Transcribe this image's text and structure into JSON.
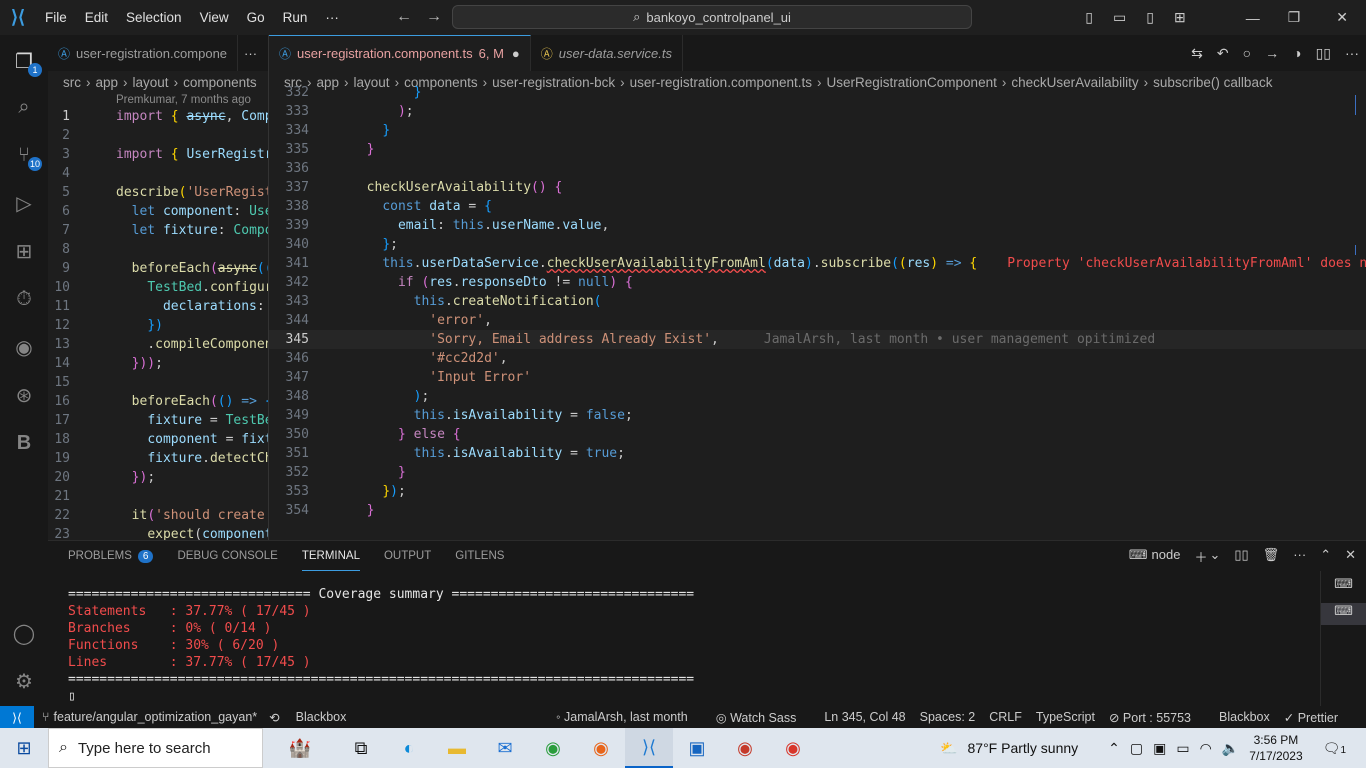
{
  "titlebar": {
    "menu": [
      "File",
      "Edit",
      "Selection",
      "View",
      "Go",
      "Run",
      "···"
    ],
    "search_text": "bankoyo_controlpanel_ui"
  },
  "activity": {
    "explorer_badge": "1",
    "scm_badge": "10"
  },
  "left_pane": {
    "tab_label": "user-registration.compone",
    "crumbs": [
      "src",
      "app",
      "layout",
      "components"
    ],
    "blame": "Premkumar, 7 months ago",
    "lines": [
      {
        "n": "1",
        "html": "<span class='k'>import</span> <span class='p'>{</span> <span class='v' style='text-decoration:line-through'>async</span>, <span class='v'>Comp</span>"
      },
      {
        "n": "2",
        "html": ""
      },
      {
        "n": "3",
        "html": "<span class='k'>import</span> <span class='p'>{</span> <span class='v'>UserRegistr</span>"
      },
      {
        "n": "4",
        "html": ""
      },
      {
        "n": "5",
        "html": "<span class='f'>describe</span><span class='p'>(</span><span class='s'>'UserRegist</span>"
      },
      {
        "n": "6",
        "html": "  <span class='kw'>let</span> <span class='v'>component</span>: <span class='t'>Use</span>"
      },
      {
        "n": "7",
        "html": "  <span class='kw'>let</span> <span class='v'>fixture</span>: <span class='t'>Compo</span>"
      },
      {
        "n": "8",
        "html": ""
      },
      {
        "n": "9",
        "html": "  <span class='f'>beforeEach</span><span class='g'>(</span><span class='f' style='text-decoration:line-through'>async</span><span class='b'>((</span>"
      },
      {
        "n": "10",
        "html": "    <span class='t'>TestBed</span>.<span class='f'>configur</span>"
      },
      {
        "n": "11",
        "html": "      <span class='v'>declarations</span>:"
      },
      {
        "n": "12",
        "html": "    <span class='b'>})</span>"
      },
      {
        "n": "13",
        "html": "    .<span class='f'>compileComponen</span>"
      },
      {
        "n": "14",
        "html": "  <span class='g'>}))</span>;"
      },
      {
        "n": "15",
        "html": ""
      },
      {
        "n": "16",
        "html": "  <span class='f'>beforeEach</span><span class='g'>(</span><span class='b'>()</span> <span class='kw'>=></span> <span class='b'>{</span>"
      },
      {
        "n": "17",
        "html": "    <span class='v'>fixture</span> = <span class='t'>TestBe</span>"
      },
      {
        "n": "18",
        "html": "    <span class='v'>component</span> = <span class='v'>fixt</span>"
      },
      {
        "n": "19",
        "html": "    <span class='v'>fixture</span>.<span class='f'>detectCh</span>"
      },
      {
        "n": "20",
        "html": "  <span class='g'>})</span>;"
      },
      {
        "n": "21",
        "html": ""
      },
      {
        "n": "22",
        "html": "  <span class='f'>it</span><span class='g'>(</span><span class='s'>'should create'</span>"
      },
      {
        "n": "23",
        "html": "    <span class='f'>expect</span>(<span class='v'>component</span>"
      }
    ]
  },
  "right_pane": {
    "tabs": [
      {
        "label": "user-registration.component.ts",
        "status": "6, M",
        "active": true
      },
      {
        "label": "user-data.service.ts",
        "active": false
      }
    ],
    "crumbs": [
      "src",
      "app",
      "layout",
      "components",
      "user-registration-bck",
      "user-registration.component.ts",
      "UserRegistrationComponent",
      "checkUserAvailability",
      "subscribe() callback"
    ],
    "error_text": "Property 'checkUserAvailabilityFromAml' does not e",
    "inline_blame": "JamalArsh, last month • user management opitimized",
    "lines": [
      {
        "n": "332",
        "html": "        <span class='b'>}</span>"
      },
      {
        "n": "333",
        "html": "      <span class='g'>)</span>;"
      },
      {
        "n": "334",
        "html": "    <span class='b'>}</span>"
      },
      {
        "n": "335",
        "html": "  <span class='g'>}</span>"
      },
      {
        "n": "336",
        "html": ""
      },
      {
        "n": "337",
        "html": "  <span class='f'>checkUserAvailability</span><span class='g'>()</span> <span class='g'>{</span>"
      },
      {
        "n": "338",
        "html": "    <span class='kw'>const</span> <span class='v'>data</span> = <span class='b'>{</span>"
      },
      {
        "n": "339",
        "html": "      <span class='v'>email</span>: <span class='kw'>this</span>.<span class='v'>userName</span>.<span class='v'>value</span>,"
      },
      {
        "n": "340",
        "html": "    <span class='b'>}</span>;"
      },
      {
        "n": "341",
        "html": "    <span class='kw'>this</span>.<span class='v'>userDataService</span>.<span class='f squig'>checkUserAvailabilityFromAml</span><span class='b'>(</span><span class='v'>data</span><span class='b'>)</span>.<span class='f'>subscribe</span><span class='b'>(</span><span class='p'>(</span><span class='v'>res</span><span class='p'>)</span> <span class='kw'>=></span> <span class='p'>{</span>",
        "err": true
      },
      {
        "n": "342",
        "html": "      <span class='k'>if</span> <span class='g'>(</span><span class='v'>res</span>.<span class='v'>responseDto</span> != <span class='kw'>null</span><span class='g'>)</span> <span class='g'>{</span>"
      },
      {
        "n": "343",
        "html": "        <span class='kw'>this</span>.<span class='f'>createNotification</span><span class='b'>(</span>"
      },
      {
        "n": "344",
        "html": "          <span class='s'>'error'</span>,"
      },
      {
        "n": "345",
        "html": "          <span class='s'>'Sorry, Email address Already Exist'</span>,",
        "cur": true
      },
      {
        "n": "346",
        "html": "          <span class='s'>'#cc2d2d'</span>,"
      },
      {
        "n": "347",
        "html": "          <span class='s'>'Input Error'</span>"
      },
      {
        "n": "348",
        "html": "        <span class='b'>)</span>;"
      },
      {
        "n": "349",
        "html": "        <span class='kw'>this</span>.<span class='v'>isAvailability</span> = <span class='kw'>false</span>;"
      },
      {
        "n": "350",
        "html": "      <span class='g'>}</span> <span class='k'>else</span> <span class='g'>{</span>"
      },
      {
        "n": "351",
        "html": "        <span class='kw'>this</span>.<span class='v'>isAvailability</span> = <span class='kw'>true</span>;"
      },
      {
        "n": "352",
        "html": "      <span class='g'>}</span>"
      },
      {
        "n": "353",
        "html": "    <span class='p'>}</span><span class='b'>)</span>;"
      },
      {
        "n": "354",
        "html": "  <span class='g'>}</span>"
      }
    ]
  },
  "panel": {
    "tabs": [
      {
        "label": "PROBLEMS",
        "badge": "6"
      },
      {
        "label": "DEBUG CONSOLE"
      },
      {
        "label": "TERMINAL",
        "active": true
      },
      {
        "label": "OUTPUT"
      },
      {
        "label": "GITLENS"
      }
    ],
    "terminal_name": "node",
    "coverage_header": "=============================== Coverage summary ===============================",
    "coverage": [
      "Statements   : 37.77% ( 17/45 )",
      "Branches     : 0% ( 0/14 )",
      "Functions    : 30% ( 6/20 )",
      "Lines        : 37.77% ( 17/45 )"
    ],
    "coverage_footer": "================================================================================",
    "prompt": "▯"
  },
  "statusbar": {
    "branch": "feature/angular_optimization_gayan*",
    "blackbox_left": "Blackbox",
    "blame": "JamalArsh, last month",
    "watch_sass": "Watch Sass",
    "position": "Ln 345, Col 48",
    "spaces": "Spaces: 2",
    "eol": "CRLF",
    "language": "TypeScript",
    "port": "Port : 55753",
    "blackbox_right": "Blackbox",
    "prettier": "Prettier"
  },
  "taskbar": {
    "search_placeholder": "Type here to search",
    "weather": "87°F  Partly sunny",
    "time": "3:56 PM",
    "date": "7/17/2023",
    "notif": "1"
  }
}
